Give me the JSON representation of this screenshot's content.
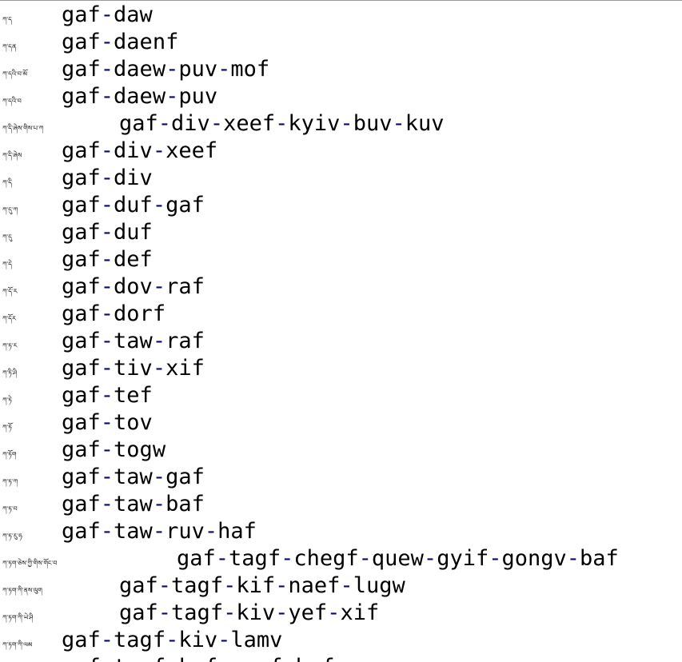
{
  "entries": [
    {
      "tibetan": "ཀ་ད",
      "romanization": "gaf-daw"
    },
    {
      "tibetan": "ཀ་དན",
      "romanization": "gaf-daenf"
    },
    {
      "tibetan": "ཀ་དའི་བ་མོ",
      "romanization": "gaf-daew-puv-mof"
    },
    {
      "tibetan": "ཀ་དའི་བ",
      "romanization": "gaf-daew-puv"
    },
    {
      "tibetan": "ཀ་དི་ཞེས་གིས་པ་ཀ",
      "romanization": "gaf-div-xeef-kyiv-buv-kuv"
    },
    {
      "tibetan": "ཀ་དི་ཞེས",
      "romanization": "gaf-div-xeef"
    },
    {
      "tibetan": "ཀ་དི",
      "romanization": "gaf-div"
    },
    {
      "tibetan": "ཀ་དུ་ཀ",
      "romanization": "gaf-duf-gaf"
    },
    {
      "tibetan": "ཀ་དུ",
      "romanization": "gaf-duf"
    },
    {
      "tibetan": "ཀ་དེ",
      "romanization": "gaf-def"
    },
    {
      "tibetan": "ཀ་དོ་ར",
      "romanization": "gaf-dov-raf"
    },
    {
      "tibetan": "ཀ་དོར",
      "romanization": "gaf-dorf"
    },
    {
      "tibetan": "ཀ་ཏ་ར",
      "romanization": "gaf-taw-raf"
    },
    {
      "tibetan": "ཀ་ཏི་ཤི",
      "romanization": "gaf-tiv-xif"
    },
    {
      "tibetan": "ཀ་ཏེ",
      "romanization": "gaf-tef"
    },
    {
      "tibetan": "ཀ་ཏོ",
      "romanization": "gaf-tov"
    },
    {
      "tibetan": "ཀ་ཏོག",
      "romanization": "gaf-togw"
    },
    {
      "tibetan": "ཀ་ཏ་ཀ",
      "romanization": "gaf-taw-gaf"
    },
    {
      "tibetan": "ཀ་ཏ་བ",
      "romanization": "gaf-taw-baf"
    },
    {
      "tibetan": "ཀ་ཏ་རུ་ཧ",
      "romanization": "gaf-taw-ruv-haf"
    },
    {
      "tibetan": "ཀ་ཏག་ཅེས་ཀྱི་གིས་གོང་བ",
      "romanization": "gaf-tagf-chegf-quew-gyif-gongv-baf"
    },
    {
      "tibetan": "ཀ་ཏག་ཀི་ནས་ལུག",
      "romanization": "gaf-tagf-kif-naef-lugw"
    },
    {
      "tibetan": "ཀ་ཏག་ཀི་ཡེ་ཤི",
      "romanization": "gaf-tagf-kiv-yef-xif"
    },
    {
      "tibetan": "ཀ་ཏག་ཀི་ལམ",
      "romanization": "gaf-tagf-kiv-lamv"
    },
    {
      "tibetan": "ཀ་ཏག་ཀི",
      "romanization": "gaf-tagf-kof-nawf-hef"
    }
  ]
}
